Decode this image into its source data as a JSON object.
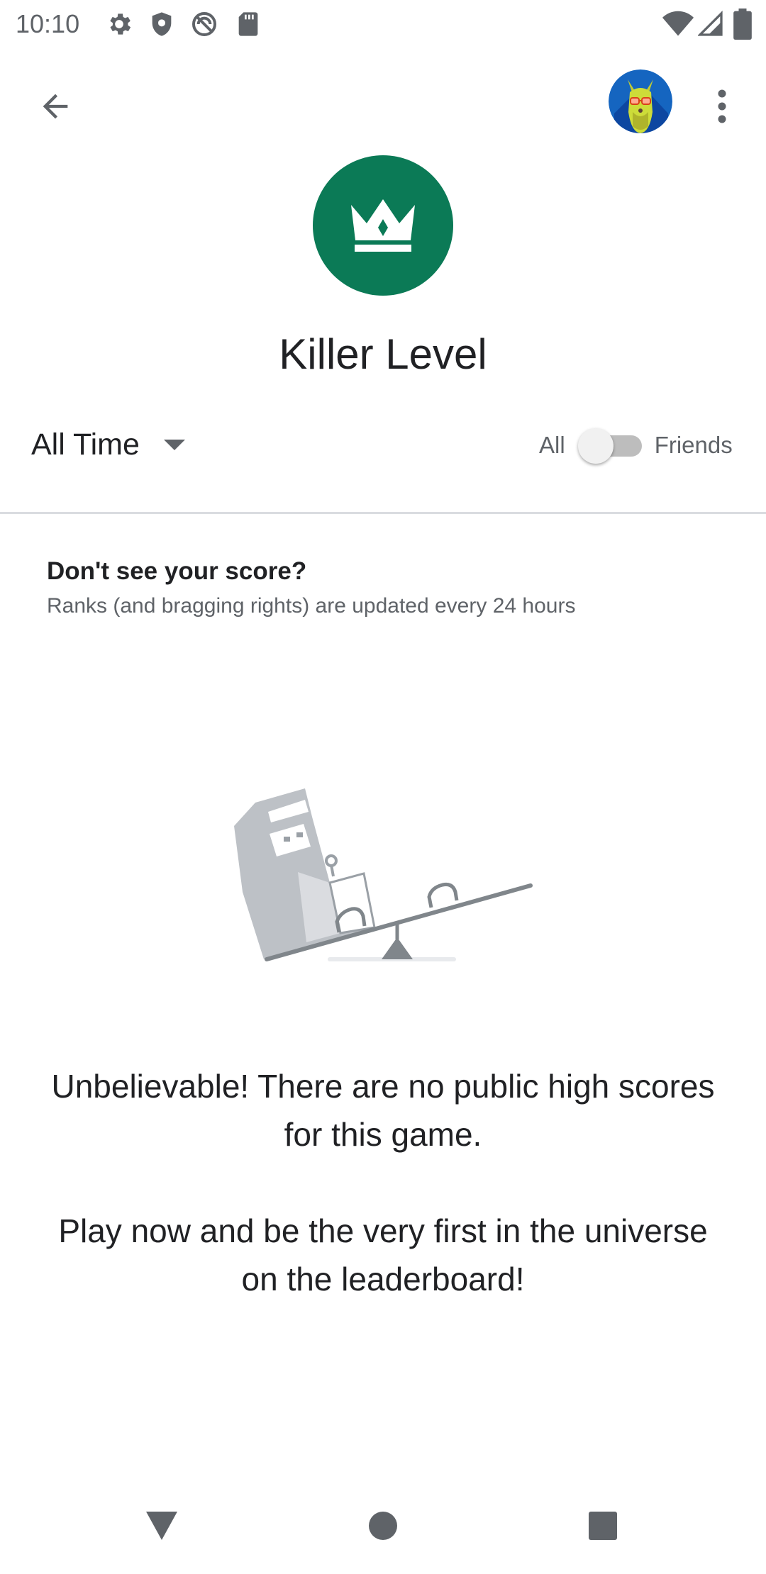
{
  "status_bar": {
    "time": "10:10",
    "left_icons": [
      "gear-icon",
      "shield-icon",
      "vpn-icon",
      "sd-card-icon"
    ],
    "right_icons": [
      "wifi-icon",
      "signal-icon",
      "battery-icon"
    ]
  },
  "top_bar": {
    "back_icon": "arrow-back-icon",
    "avatar": "llama-avatar",
    "more_icon": "more-vert-icon"
  },
  "header": {
    "badge_icon": "crown-icon",
    "badge_color": "#0b7a56",
    "title": "Killer Level"
  },
  "filters": {
    "time_range": "All Time",
    "scope_left": "All",
    "scope_right": "Friends",
    "friends_only": false
  },
  "info": {
    "heading": "Don't see your score?",
    "subtext": "Ranks (and bragging rights) are updated every 24 hours"
  },
  "empty_state": {
    "illustration": "arcade-seesaw-illustration",
    "message_1": "Unbelievable! There are no public high scores for this game.",
    "message_2": "Play now and be the very first in the universe on the leaderboard!"
  },
  "nav_bar": {
    "back": "nav-back-icon",
    "home": "nav-home-icon",
    "recents": "nav-recents-icon"
  }
}
